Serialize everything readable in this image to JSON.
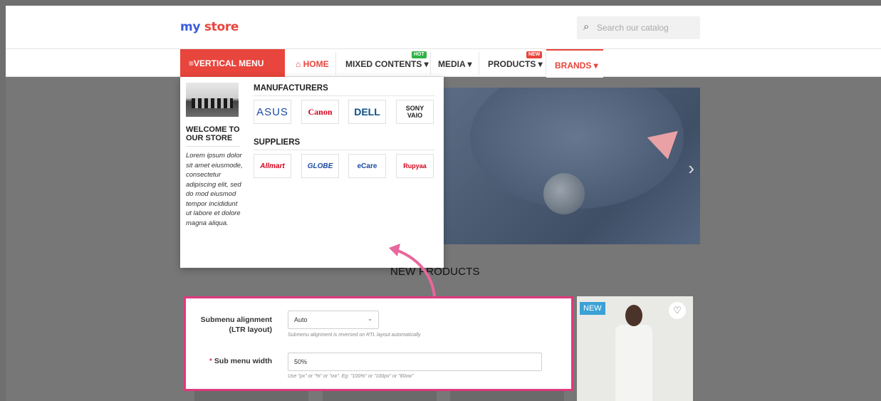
{
  "header": {
    "logo_part1": "my",
    "logo_part2": "store",
    "search_placeholder": "Search our catalog",
    "search_icon": "search-icon"
  },
  "nav": {
    "vertical_menu": "≡VERTICAL MENU",
    "home": "⌂ HOME",
    "mixed_contents": "MIXED CONTENTS ▾",
    "mixed_badge": "HOT",
    "media": "MEDIA ▾",
    "products": "PRODUCTS ▾",
    "products_badge": "NEW",
    "brands": "BRANDS ▾"
  },
  "dropdown": {
    "welcome_title": "WELCOME TO OUR STORE",
    "welcome_text": "Lorem ipsum dolor sit amet eiusmode, consectetur adipiscing elit, sed do mod eiusmod tempor incididunt ut labore et dolore magna aliqua.",
    "manufacturers_heading": "MANUFACTURERS",
    "suppliers_heading": "SUPPLIERS",
    "manufacturers": [
      "ASUS",
      "Canon",
      "DELL",
      "SONY VAIO"
    ],
    "suppliers": [
      "Allmart",
      "GLOBE",
      "eCare",
      "Rupyaa"
    ]
  },
  "main": {
    "section_title": "NEW PRODUCTS",
    "product_badge": "NEW",
    "hero_next": "›"
  },
  "settings": {
    "align_label": "Submenu alignment (LTR layout)",
    "align_value": "Auto",
    "align_hint": "Submenu alignment is reversed on RTL layout automatically",
    "width_label": "Sub menu width",
    "width_required": "*",
    "width_value": "50%",
    "width_hint": "Use \"px\" or \"%\" or \"vw\". Eg: \"100%\" or \"100px\" or \"80vw\""
  },
  "colors": {
    "accent": "#e8453c",
    "highlight": "#e0397d",
    "hot": "#2fb344",
    "new_badge": "#3aa1d5"
  }
}
